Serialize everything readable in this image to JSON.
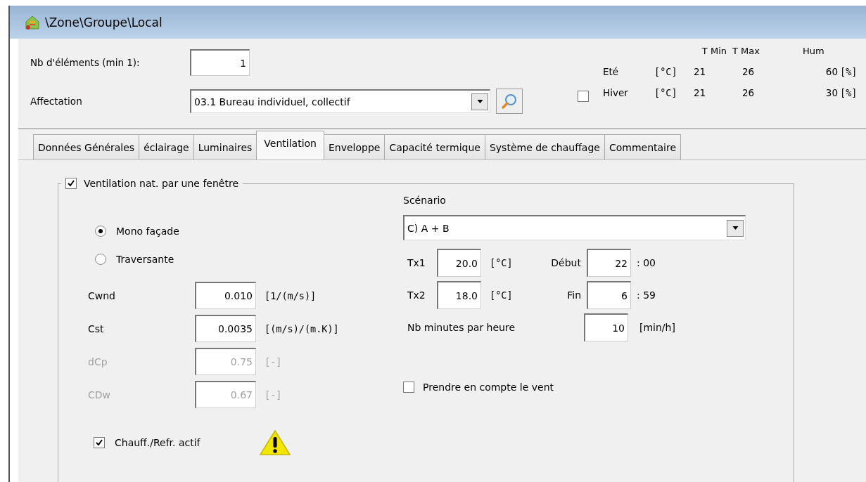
{
  "window": {
    "title": "\\Zone\\Groupe\\Local"
  },
  "header": {
    "count_label": "Nb d'éléments (min 1):",
    "count_value": "1",
    "affectation_label": "Affectation",
    "affectation_value": "03.1 Bureau individuel, collectif",
    "season_checkbox": {
      "checked": false
    },
    "climate_columns": [
      "T Min",
      "T Max",
      "Hum"
    ],
    "seasons": [
      {
        "name": "Eté",
        "unit": "[°C]",
        "t_min": "21",
        "t_max": "26",
        "hum": "60",
        "hum_unit": "[%]"
      },
      {
        "name": "Hiver",
        "unit": "[°C]",
        "t_min": "21",
        "t_max": "26",
        "hum": "30",
        "hum_unit": "[%]"
      }
    ]
  },
  "tabs": [
    {
      "label": "Données Générales",
      "selected": false
    },
    {
      "label": "éclairage",
      "selected": false
    },
    {
      "label": "Luminaires",
      "selected": false
    },
    {
      "label": "Ventilation",
      "selected": true
    },
    {
      "label": "Enveloppe",
      "selected": false
    },
    {
      "label": "Capacité termique",
      "selected": false
    },
    {
      "label": "Système de chauffage",
      "selected": false
    },
    {
      "label": "Commentaire",
      "selected": false
    }
  ],
  "ventilation": {
    "label": "Ventilation nat. par une fenêtre",
    "checked": true,
    "radios": [
      {
        "label": "Mono façade",
        "selected": true
      },
      {
        "label": "Traversante",
        "selected": false
      }
    ],
    "coefficients": [
      {
        "label": "Cwnd",
        "value": "0.010",
        "unit": "[1/(m/s)]",
        "disabled": false
      },
      {
        "label": "Cst",
        "value": "0.0035",
        "unit": "[(m/s)/(m.K)]",
        "disabled": false
      },
      {
        "label": "dCp",
        "value": "0.75",
        "unit": "[-]",
        "disabled": true
      },
      {
        "label": "CDw",
        "value": "0.67",
        "unit": "[-]",
        "disabled": true
      }
    ],
    "heating": {
      "label": "Chauff./Refr. actif",
      "checked": true
    },
    "scenario_label": "Scénario",
    "scenario_value": "C) A + B",
    "temperatures": [
      {
        "label": "Tx1",
        "value": "20.0",
        "unit": "[°C]",
        "time_label": "Début",
        "hour": "22",
        "minutes": ": 00"
      },
      {
        "label": "Tx2",
        "value": "18.0",
        "unit": "[°C]",
        "time_label": "Fin",
        "hour": "6",
        "minutes": ": 59"
      }
    ],
    "minutes_per_hour": {
      "label": "Nb minutes par heure",
      "value": "10",
      "unit": "[min/h]"
    },
    "wind": {
      "label": "Prendre en compte le vent",
      "checked": false
    }
  }
}
